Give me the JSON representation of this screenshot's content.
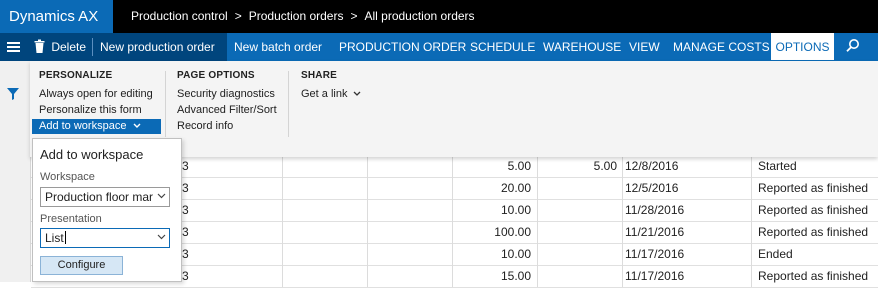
{
  "app": {
    "title": "Dynamics AX"
  },
  "breadcrumbs": [
    "Production control",
    "Production orders",
    "All production orders"
  ],
  "actionbar": {
    "delete_label": "Delete",
    "new_production_order": "New production order",
    "new_batch_order": "New batch order",
    "tabs": [
      "PRODUCTION ORDER",
      "SCHEDULE",
      "WAREHOUSE",
      "VIEW",
      "MANAGE COSTS",
      "OPTIONS"
    ],
    "active_tab": "OPTIONS"
  },
  "ribbon": {
    "groups": [
      {
        "title": "PERSONALIZE",
        "items": [
          "Always open for editing",
          "Personalize this form",
          "Add to workspace"
        ]
      },
      {
        "title": "PAGE OPTIONS",
        "items": [
          "Security diagnostics",
          "Advanced Filter/Sort",
          "Record info"
        ]
      },
      {
        "title": "SHARE",
        "items": [
          "Get a link"
        ]
      }
    ]
  },
  "workspace_panel": {
    "title": "Add to workspace",
    "workspace_label": "Workspace",
    "workspace_value": "Production floor mar",
    "presentation_label": "Presentation",
    "presentation_value": "List",
    "configure_label": "Configure"
  },
  "grid": {
    "rows": [
      {
        "c1": "3",
        "qty": "5.00",
        "qty2": "5.00",
        "date": "12/8/2016",
        "status": "Started"
      },
      {
        "c1": "3",
        "qty": "20.00",
        "qty2": "",
        "date": "12/5/2016",
        "status": "Reported as finished"
      },
      {
        "c1": "3",
        "qty": "10.00",
        "qty2": "",
        "date": "11/28/2016",
        "status": "Reported as finished"
      },
      {
        "c1": "3",
        "qty": "100.00",
        "qty2": "",
        "date": "11/21/2016",
        "status": "Reported as finished"
      },
      {
        "c1": "3",
        "qty": "10.00",
        "qty2": "",
        "date": "11/17/2016",
        "status": "Ended"
      },
      {
        "c1": "3",
        "qty": "15.00",
        "qty2": "",
        "date": "11/17/2016",
        "status": "Reported as finished"
      }
    ]
  },
  "colors": {
    "brand": "#0b6ab6",
    "dark": "#00457d",
    "selected": "#0b6ab6"
  }
}
